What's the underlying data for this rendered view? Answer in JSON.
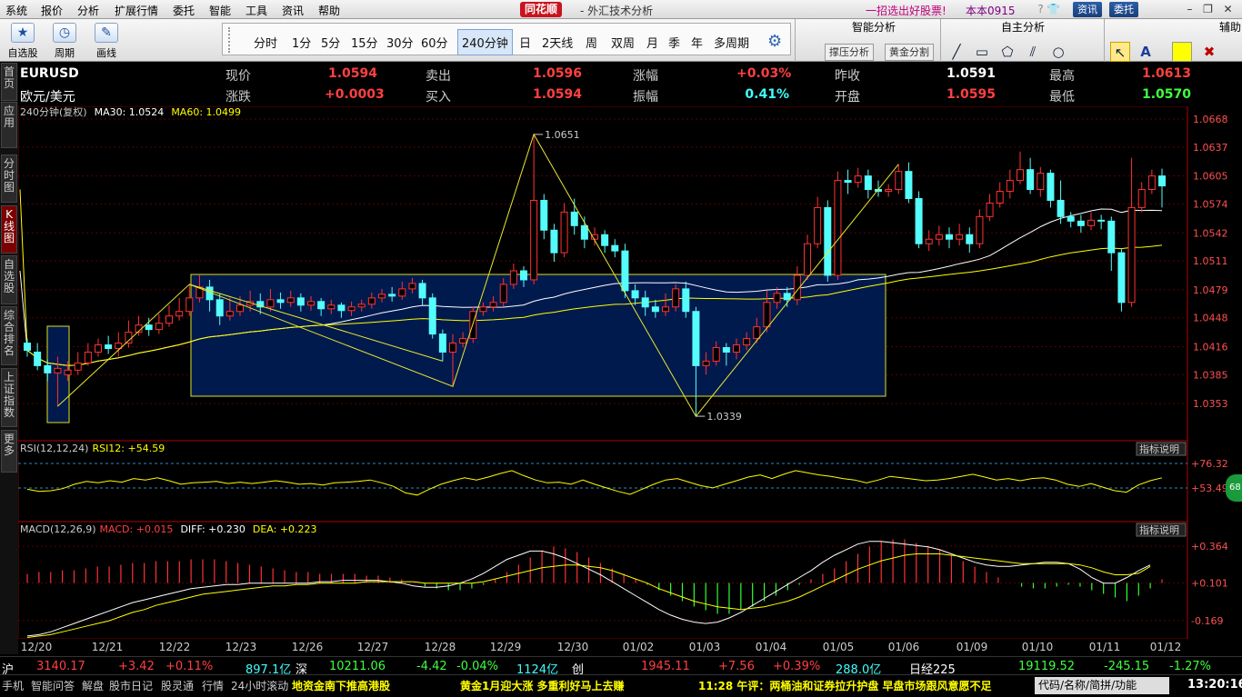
{
  "menu": [
    "系统",
    "报价",
    "分析",
    "扩展行情",
    "委托",
    "智能",
    "工具",
    "资讯",
    "帮助"
  ],
  "app": {
    "logo": "同花顺",
    "title": "- 外汇技术分析",
    "promo": "一招选出好股票!",
    "user": "本本0915",
    "btn_info": "资讯",
    "btn_trade": "委托"
  },
  "toolbar": {
    "tools": [
      {
        "label": "自选股",
        "icon": "star-icon"
      },
      {
        "label": "周期",
        "icon": "clock-icon"
      },
      {
        "label": "画线",
        "icon": "pencil-icon"
      }
    ],
    "periods": [
      "分时",
      "1分",
      "5分",
      "15分",
      "30分",
      "60分",
      "240分钟",
      "日",
      "2天线",
      "周",
      "双周",
      "月",
      "季",
      "年",
      "多周期"
    ],
    "active_period": "240分钟",
    "smart_title": "智能分析",
    "smart_btn1": "撑压分析",
    "smart_btn2": "黄金分割",
    "self_title": "自主分析",
    "aux_title": "辅助"
  },
  "side_tabs": [
    {
      "label": "首页"
    },
    {
      "label": "应用"
    },
    {
      "label": "分时图"
    },
    {
      "label": "K线图",
      "active": true
    },
    {
      "label": "自选股"
    },
    {
      "label": "综合排名"
    },
    {
      "label": "上证指数"
    },
    {
      "label": "更多"
    }
  ],
  "quote": {
    "symbol": "EURUSD",
    "name": "欧元/美元",
    "row1": [
      {
        "label": "现价",
        "value": "1.0594",
        "color": "#ff4040"
      },
      {
        "label": "卖出",
        "value": "1.0596",
        "color": "#ff4040"
      },
      {
        "label": "涨幅",
        "value": "+0.03%",
        "color": "#ff4040"
      },
      {
        "label": "昨收",
        "value": "1.0591",
        "color": "#ffffff"
      },
      {
        "label": "最高",
        "value": "1.0613",
        "color": "#ff4040"
      }
    ],
    "row2": [
      {
        "label": "涨跌",
        "value": "+0.0003",
        "color": "#ff4040"
      },
      {
        "label": "买入",
        "value": "1.0594",
        "color": "#ff4040"
      },
      {
        "label": "振幅",
        "value": "0.41%",
        "color": "#40ffff"
      },
      {
        "label": "开盘",
        "value": "1.0595",
        "color": "#ff4040"
      },
      {
        "label": "最低",
        "value": "1.0570",
        "color": "#40ff40"
      }
    ]
  },
  "chart_data": {
    "type": "candlestick",
    "period_label": "240分钟(复权)",
    "ma_legend": [
      {
        "text": "MA30: 1.0524",
        "color": "#ffffff"
      },
      {
        "text": "MA60: 1.0499",
        "color": "#ffff00"
      }
    ],
    "ylim": [
      1.033,
      1.0668
    ],
    "y_ticks": [
      "1.0668",
      "1.0637",
      "1.0605",
      "1.0574",
      "1.0542",
      "1.0511",
      "1.0479",
      "1.0448",
      "1.0416",
      "1.0385",
      "1.0353"
    ],
    "x_labels": [
      "12/20",
      "12/21",
      "12/22",
      "12/23",
      "12/26",
      "12/27",
      "12/28",
      "12/29",
      "12/30",
      "01/02",
      "01/03",
      "01/04",
      "01/05",
      "01/06",
      "01/09",
      "01/10",
      "01/11",
      "01/12"
    ],
    "high_marker": "1.0651",
    "low_marker": "1.0339",
    "candles": [
      [
        1.042,
        1.0412,
        1.0425,
        1.0405
      ],
      [
        1.041,
        1.0395,
        1.042,
        1.039
      ],
      [
        1.0395,
        1.0387,
        1.0402,
        1.0378
      ],
      [
        1.0387,
        1.0392,
        1.0405,
        1.035
      ],
      [
        1.0385,
        1.039,
        1.04,
        1.0378
      ],
      [
        1.039,
        1.0398,
        1.041,
        1.0385
      ],
      [
        1.0398,
        1.041,
        1.042,
        1.0395
      ],
      [
        1.041,
        1.0418,
        1.0425,
        1.0405
      ],
      [
        1.0418,
        1.0414,
        1.0428,
        1.0408
      ],
      [
        1.0414,
        1.042,
        1.0432,
        1.0405
      ],
      [
        1.042,
        1.0432,
        1.0445,
        1.0415
      ],
      [
        1.0432,
        1.044,
        1.045,
        1.0428
      ],
      [
        1.044,
        1.0435,
        1.0448,
        1.0428
      ],
      [
        1.0435,
        1.0442,
        1.0452,
        1.043
      ],
      [
        1.0442,
        1.045,
        1.0462,
        1.0438
      ],
      [
        1.045,
        1.0455,
        1.047,
        1.0445
      ],
      [
        1.0455,
        1.047,
        1.0485,
        1.045
      ],
      [
        1.047,
        1.0482,
        1.0495,
        1.0465
      ],
      [
        1.0482,
        1.0468,
        1.049,
        1.0455
      ],
      [
        1.0468,
        1.045,
        1.0475,
        1.044
      ],
      [
        1.045,
        1.0455,
        1.047,
        1.0445
      ],
      [
        1.0455,
        1.0462,
        1.0472,
        1.045
      ],
      [
        1.0462,
        1.0466,
        1.0478,
        1.0455
      ],
      [
        1.0466,
        1.046,
        1.0475,
        1.0452
      ],
      [
        1.046,
        1.0468,
        1.048,
        1.0455
      ],
      [
        1.0468,
        1.0465,
        1.0476,
        1.0458
      ],
      [
        1.0465,
        1.047,
        1.0478,
        1.046
      ],
      [
        1.047,
        1.0462,
        1.0475,
        1.0455
      ],
      [
        1.0462,
        1.0466,
        1.0472,
        1.0456
      ],
      [
        1.0466,
        1.0458,
        1.047,
        1.045
      ],
      [
        1.0458,
        1.0462,
        1.0468,
        1.0452
      ],
      [
        1.0462,
        1.0456,
        1.0465,
        1.0448
      ],
      [
        1.0456,
        1.046,
        1.0466,
        1.045
      ],
      [
        1.046,
        1.0463,
        1.0468,
        1.0455
      ],
      [
        1.0463,
        1.047,
        1.0476,
        1.0458
      ],
      [
        1.047,
        1.0474,
        1.048,
        1.0465
      ],
      [
        1.0474,
        1.0472,
        1.0482,
        1.0466
      ],
      [
        1.0472,
        1.048,
        1.0488,
        1.0468
      ],
      [
        1.048,
        1.0486,
        1.0492,
        1.0475
      ],
      [
        1.0486,
        1.047,
        1.049,
        1.0462
      ],
      [
        1.047,
        1.043,
        1.0475,
        1.0425
      ],
      [
        1.043,
        1.041,
        1.0435,
        1.04
      ],
      [
        1.041,
        1.042,
        1.043,
        1.0372
      ],
      [
        1.042,
        1.0425,
        1.0432,
        1.0415
      ],
      [
        1.0425,
        1.0455,
        1.046,
        1.042
      ],
      [
        1.0455,
        1.046,
        1.0465,
        1.045
      ],
      [
        1.046,
        1.0465,
        1.0472,
        1.0455
      ],
      [
        1.0465,
        1.0485,
        1.0492,
        1.046
      ],
      [
        1.0485,
        1.05,
        1.0508,
        1.048
      ],
      [
        1.05,
        1.049,
        1.0505,
        1.0482
      ],
      [
        1.049,
        1.0578,
        1.0651,
        1.0485
      ],
      [
        1.0578,
        1.0545,
        1.0585,
        1.0535
      ],
      [
        1.0545,
        1.052,
        1.0552,
        1.051
      ],
      [
        1.052,
        1.0565,
        1.0575,
        1.0515
      ],
      [
        1.0565,
        1.055,
        1.058,
        1.054
      ],
      [
        1.055,
        1.0535,
        1.056,
        1.0525
      ],
      [
        1.0535,
        1.054,
        1.0548,
        1.0528
      ],
      [
        1.054,
        1.0528,
        1.0545,
        1.052
      ],
      [
        1.0528,
        1.0522,
        1.0535,
        1.0515
      ],
      [
        1.0522,
        1.0478,
        1.053,
        1.047
      ],
      [
        1.0478,
        1.047,
        1.0485,
        1.0462
      ],
      [
        1.047,
        1.046,
        1.0478,
        1.045
      ],
      [
        1.046,
        1.0455,
        1.0468,
        1.0448
      ],
      [
        1.0455,
        1.046,
        1.0475,
        1.045
      ],
      [
        1.046,
        1.048,
        1.0485,
        1.0455
      ],
      [
        1.048,
        1.0455,
        1.0488,
        1.0448
      ],
      [
        1.0455,
        1.0395,
        1.046,
        1.0339
      ],
      [
        1.0395,
        1.04,
        1.041,
        1.0385
      ],
      [
        1.04,
        1.0415,
        1.0422,
        1.0395
      ],
      [
        1.0415,
        1.041,
        1.042,
        1.0395
      ],
      [
        1.041,
        1.0418,
        1.0425,
        1.0402
      ],
      [
        1.0418,
        1.0425,
        1.0432,
        1.0412
      ],
      [
        1.0425,
        1.0438,
        1.0448,
        1.042
      ],
      [
        1.0438,
        1.0465,
        1.0478,
        1.0432
      ],
      [
        1.0465,
        1.0475,
        1.0482,
        1.0458
      ],
      [
        1.0475,
        1.0468,
        1.0482,
        1.046
      ],
      [
        1.0468,
        1.0495,
        1.0505,
        1.0462
      ],
      [
        1.0495,
        1.053,
        1.054,
        1.049
      ],
      [
        1.053,
        1.057,
        1.0582,
        1.0525
      ],
      [
        1.057,
        1.0495,
        1.0578,
        1.0488
      ],
      [
        1.0495,
        1.06,
        1.061,
        1.049
      ],
      [
        1.06,
        1.0598,
        1.0612,
        1.0585
      ],
      [
        1.0598,
        1.0605,
        1.0614,
        1.0592
      ],
      [
        1.0605,
        1.059,
        1.0612,
        1.058
      ],
      [
        1.059,
        1.0588,
        1.06,
        1.0582
      ],
      [
        1.0588,
        1.059,
        1.0596,
        1.0582
      ],
      [
        1.059,
        1.061,
        1.0618,
        1.0585
      ],
      [
        1.061,
        1.058,
        1.062,
        1.0575
      ],
      [
        1.058,
        1.053,
        1.0588,
        1.0525
      ],
      [
        1.053,
        1.0535,
        1.0545,
        1.0522
      ],
      [
        1.0535,
        1.054,
        1.055,
        1.0528
      ],
      [
        1.054,
        1.0535,
        1.0548,
        1.0525
      ],
      [
        1.0535,
        1.054,
        1.0552,
        1.0528
      ],
      [
        1.054,
        1.053,
        1.0548,
        1.052
      ],
      [
        1.053,
        1.056,
        1.0568,
        1.0525
      ],
      [
        1.056,
        1.0575,
        1.0585,
        1.0555
      ],
      [
        1.0575,
        1.0588,
        1.0598,
        1.057
      ],
      [
        1.0588,
        1.06,
        1.0612,
        1.058
      ],
      [
        1.06,
        1.0612,
        1.0632,
        1.0596
      ],
      [
        1.0612,
        1.059,
        1.0625,
        1.0585
      ],
      [
        1.059,
        1.0608,
        1.0615,
        1.0582
      ],
      [
        1.0608,
        1.0578,
        1.0612,
        1.057
      ],
      [
        1.0578,
        1.056,
        1.06,
        1.0552
      ],
      [
        1.056,
        1.0555,
        1.0565,
        1.0548
      ],
      [
        1.0555,
        1.055,
        1.0562,
        1.0542
      ],
      [
        1.055,
        1.0556,
        1.0565,
        1.0545
      ],
      [
        1.0556,
        1.0555,
        1.0562,
        1.0546
      ],
      [
        1.0555,
        1.052,
        1.056,
        1.05
      ],
      [
        1.052,
        1.0465,
        1.0525,
        1.0455
      ],
      [
        1.0465,
        1.057,
        1.0625,
        1.046
      ],
      [
        1.057,
        1.059,
        1.0598,
        1.0565
      ],
      [
        1.059,
        1.0605,
        1.0612,
        1.0585
      ],
      [
        1.0605,
        1.0594,
        1.0613,
        1.057
      ]
    ],
    "rsi": {
      "legend": "RSI(12,12,24)",
      "value_label": "RSI12: +54.59",
      "tick_upper": "+76.32",
      "tick_mid": "+53.49",
      "badge": "68",
      "series": [
        45,
        42,
        43,
        46,
        52,
        56,
        54,
        57,
        55,
        60,
        58,
        61,
        57,
        52,
        54,
        55,
        56,
        53,
        55,
        53,
        55,
        57,
        55,
        52,
        53,
        51,
        54,
        55,
        56,
        58,
        54,
        49,
        40,
        37,
        45,
        52,
        57,
        61,
        58,
        62,
        67,
        71,
        64,
        58,
        54,
        55,
        52,
        58,
        52,
        47,
        42,
        38,
        45,
        52,
        58,
        60,
        55,
        50,
        47,
        52,
        57,
        62,
        65,
        60,
        66,
        71,
        68,
        65,
        63,
        60,
        58,
        54,
        58,
        63,
        61,
        59,
        57,
        58,
        60,
        63,
        66,
        62,
        58,
        60,
        57,
        60,
        61,
        58,
        52,
        49,
        53,
        48,
        43,
        41,
        51,
        57,
        61
      ]
    },
    "macd": {
      "legend": "MACD(12,26,9)",
      "macd_label": "MACD: +0.015",
      "diff_label": "DIFF: +0.230",
      "dea_label": "DEA: +0.223",
      "tick_top": "+0.364",
      "tick_mid": "+0.101",
      "tick_bot": "-0.169",
      "ylim": [
        -0.3,
        0.45
      ],
      "bars": [
        0.05,
        0.06,
        0.06,
        0.07,
        0.07,
        0.08,
        0.09,
        0.09,
        0.1,
        0.11,
        0.11,
        0.12,
        0.12,
        0.12,
        0.13,
        0.13,
        0.13,
        0.12,
        0.11,
        0.1,
        0.09,
        0.08,
        0.07,
        0.06,
        0.06,
        0.05,
        0.05,
        0.05,
        0.05,
        0.04,
        0.04,
        0.03,
        0.02,
        0.0,
        -0.02,
        -0.03,
        -0.04,
        -0.04,
        -0.03,
        -0.01,
        0.02,
        0.06,
        0.1,
        0.14,
        0.18,
        0.2,
        0.19,
        0.17,
        0.14,
        0.11,
        0.08,
        0.05,
        0.02,
        -0.01,
        -0.04,
        -0.07,
        -0.1,
        -0.13,
        -0.15,
        -0.17,
        -0.17,
        -0.15,
        -0.13,
        -0.1,
        -0.07,
        -0.04,
        -0.01,
        0.02,
        0.05,
        0.08,
        0.12,
        0.16,
        0.2,
        0.23,
        0.24,
        0.24,
        0.22,
        0.2,
        0.18,
        0.15,
        0.12,
        0.09,
        0.06,
        0.03,
        0.0,
        -0.02,
        -0.03,
        -0.03,
        -0.02,
        -0.01,
        -0.02,
        -0.04,
        -0.06,
        -0.08,
        -0.1,
        -0.07,
        -0.03,
        0.02
      ],
      "diff": [
        -0.28,
        -0.27,
        -0.25,
        -0.22,
        -0.19,
        -0.16,
        -0.13,
        -0.1,
        -0.07,
        -0.04,
        -0.02,
        0.0,
        0.02,
        0.04,
        0.06,
        0.07,
        0.08,
        0.09,
        0.09,
        0.1,
        0.1,
        0.1,
        0.1,
        0.1,
        0.1,
        0.11,
        0.11,
        0.12,
        0.12,
        0.12,
        0.12,
        0.11,
        0.1,
        0.08,
        0.07,
        0.07,
        0.08,
        0.1,
        0.13,
        0.17,
        0.22,
        0.27,
        0.3,
        0.33,
        0.33,
        0.31,
        0.28,
        0.24,
        0.2,
        0.16,
        0.11,
        0.06,
        0.01,
        -0.04,
        -0.09,
        -0.13,
        -0.16,
        -0.18,
        -0.19,
        -0.18,
        -0.15,
        -0.11,
        -0.06,
        -0.01,
        0.04,
        0.09,
        0.14,
        0.19,
        0.25,
        0.3,
        0.34,
        0.38,
        0.4,
        0.4,
        0.39,
        0.38,
        0.37,
        0.36,
        0.34,
        0.31,
        0.28,
        0.25,
        0.23,
        0.22,
        0.22,
        0.23,
        0.24,
        0.25,
        0.25,
        0.24,
        0.2,
        0.14,
        0.1,
        0.1,
        0.14,
        0.19,
        0.23
      ],
      "dea": [
        -0.29,
        -0.28,
        -0.27,
        -0.25,
        -0.23,
        -0.21,
        -0.19,
        -0.17,
        -0.14,
        -0.11,
        -0.09,
        -0.06,
        -0.04,
        -0.02,
        0.0,
        0.02,
        0.03,
        0.04,
        0.05,
        0.06,
        0.07,
        0.08,
        0.08,
        0.09,
        0.09,
        0.1,
        0.1,
        0.1,
        0.1,
        0.11,
        0.11,
        0.11,
        0.11,
        0.11,
        0.1,
        0.1,
        0.1,
        0.1,
        0.1,
        0.11,
        0.13,
        0.15,
        0.17,
        0.19,
        0.21,
        0.22,
        0.23,
        0.23,
        0.22,
        0.21,
        0.19,
        0.16,
        0.13,
        0.1,
        0.06,
        0.03,
        0.0,
        -0.03,
        -0.05,
        -0.07,
        -0.08,
        -0.09,
        -0.08,
        -0.07,
        -0.05,
        -0.03,
        0.0,
        0.04,
        0.08,
        0.12,
        0.16,
        0.2,
        0.23,
        0.26,
        0.28,
        0.3,
        0.31,
        0.31,
        0.31,
        0.3,
        0.29,
        0.28,
        0.27,
        0.26,
        0.25,
        0.24,
        0.24,
        0.24,
        0.24,
        0.24,
        0.23,
        0.21,
        0.18,
        0.16,
        0.16,
        0.17,
        0.22
      ]
    }
  },
  "indicator_btn": "指标说明",
  "index_bar": [
    {
      "t": "沪",
      "c": "#ffffff"
    },
    {
      "t": "3140.17",
      "c": "#ff4040"
    },
    {
      "t": "+3.42",
      "c": "#ff4040"
    },
    {
      "t": "+0.11%",
      "c": "#ff4040"
    },
    {
      "t": "897.1亿",
      "c": "#40ffff"
    },
    {
      "t": "深",
      "c": "#ffffff"
    },
    {
      "t": "10211.06",
      "c": "#40ff40"
    },
    {
      "t": "-4.42",
      "c": "#40ff40"
    },
    {
      "t": "-0.04%",
      "c": "#40ff40"
    },
    {
      "t": "1124亿",
      "c": "#40ffff"
    },
    {
      "t": "创",
      "c": "#ffffff"
    },
    {
      "t": "1945.11",
      "c": "#ff4040"
    },
    {
      "t": "+7.56",
      "c": "#ff4040"
    },
    {
      "t": "+0.39%",
      "c": "#ff4040"
    },
    {
      "t": "288.0亿",
      "c": "#40ffff"
    },
    {
      "t": "日经225",
      "c": "#ffffff"
    },
    {
      "t": "19119.52",
      "c": "#40ff40"
    },
    {
      "t": "-245.15",
      "c": "#40ff40"
    },
    {
      "t": "-1.27%",
      "c": "#40ff40"
    }
  ],
  "status_bar": {
    "items": [
      "手机",
      "智能问答",
      "解盘",
      "股市日记",
      "股灵通",
      "行情",
      "24小时滚动"
    ],
    "news1": "地资金南下推高港股",
    "news2": "黄金1月迎大涨 多重利好马上去赚",
    "news3": "11:28 午评：两桶油和证券拉升护盘 早盘市场跟风意愿不足",
    "search_placeholder": "代码/名称/简拼/功能",
    "clock": "13:20:16"
  }
}
